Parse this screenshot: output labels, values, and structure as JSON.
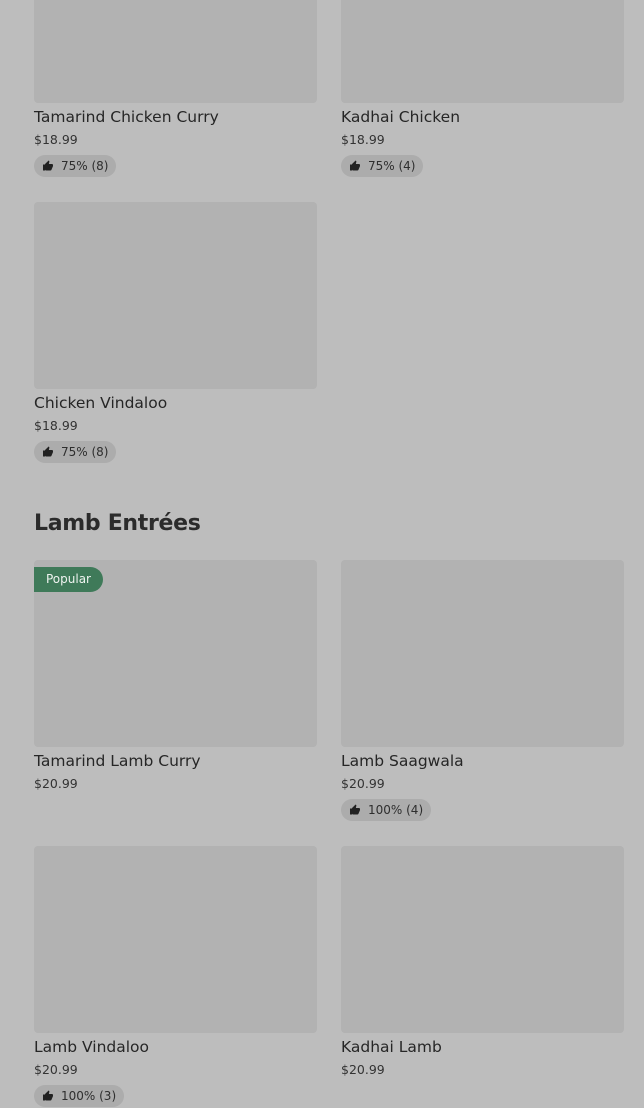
{
  "sections": [
    {
      "title": "",
      "items": [
        {
          "name": "Tamarind Chicken Curry",
          "price": "$18.99",
          "rating": "75% (8)",
          "badge": ""
        },
        {
          "name": "Kadhai Chicken",
          "price": "$18.99",
          "rating": "75% (4)",
          "badge": ""
        },
        {
          "name": "Chicken Vindaloo",
          "price": "$18.99",
          "rating": "75% (8)",
          "badge": ""
        }
      ]
    },
    {
      "title": "Lamb Entrées",
      "items": [
        {
          "name": "Tamarind Lamb Curry",
          "price": "$20.99",
          "rating": "",
          "badge": "Popular"
        },
        {
          "name": "Lamb Saagwala",
          "price": "$20.99",
          "rating": "100% (4)",
          "badge": ""
        },
        {
          "name": "Lamb Vindaloo",
          "price": "$20.99",
          "rating": "100% (3)",
          "badge": ""
        },
        {
          "name": "Kadhai Lamb",
          "price": "$20.99",
          "rating": "",
          "badge": ""
        }
      ]
    }
  ],
  "icons": {
    "rating": "thumbs-up-icon"
  },
  "colors": {
    "badge_bg": "#3f7a59",
    "page_bg": "#bdbdbd"
  }
}
